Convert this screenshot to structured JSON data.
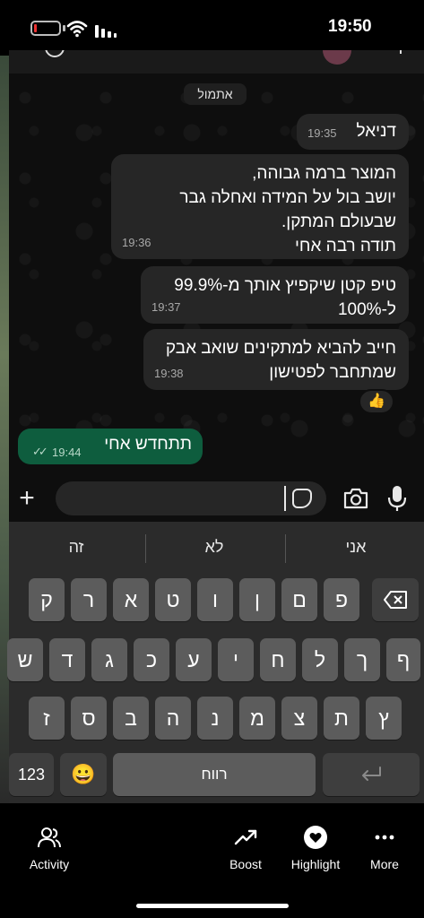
{
  "status_bar": {
    "time": "19:50"
  },
  "chat": {
    "date_divider": "אתמול",
    "messages": [
      {
        "text": "דניאל",
        "time": "19:35"
      },
      {
        "text": "המוצר ברמה גבוהה,\nיושב בול על המידה ואחלה גבר\nשבעולם המתקן.\nתודה רבה אחי",
        "time": "19:36"
      },
      {
        "text": "טיפ קטן שיקפיץ אותך מ-99.9%\nל-100%",
        "time": "19:37"
      },
      {
        "text": "חייב להביא למתקינים שואב אבק\nשמתחבר לפטישון",
        "time": "19:38"
      }
    ],
    "reaction": "👍",
    "outgoing": {
      "text": "תתחדש אחי",
      "time": "19:44",
      "ticks": "✓✓"
    }
  },
  "input": {
    "placeholder": "",
    "plus": "+"
  },
  "keyboard": {
    "suggestions": [
      "אני",
      "לא",
      "זה"
    ],
    "row1": [
      "ק",
      "ר",
      "א",
      "ט",
      "ו",
      "ן",
      "ם",
      "פ"
    ],
    "row2": [
      "ש",
      "ד",
      "ג",
      "כ",
      "ע",
      "י",
      "ח",
      "ל",
      "ך",
      "ף"
    ],
    "row3": [
      "ז",
      "ס",
      "ב",
      "ה",
      "נ",
      "מ",
      "צ",
      "ת",
      "ץ"
    ],
    "numbers_label": "123",
    "space_label": "רווח",
    "emoji": "😀"
  },
  "bottom_nav": {
    "items": [
      {
        "label": "Activity",
        "icon": "people-icon"
      },
      {
        "label": "Boost",
        "icon": "trend-up-icon"
      },
      {
        "label": "Highlight",
        "icon": "heart-icon"
      },
      {
        "label": "More",
        "icon": "more-icon"
      }
    ]
  }
}
